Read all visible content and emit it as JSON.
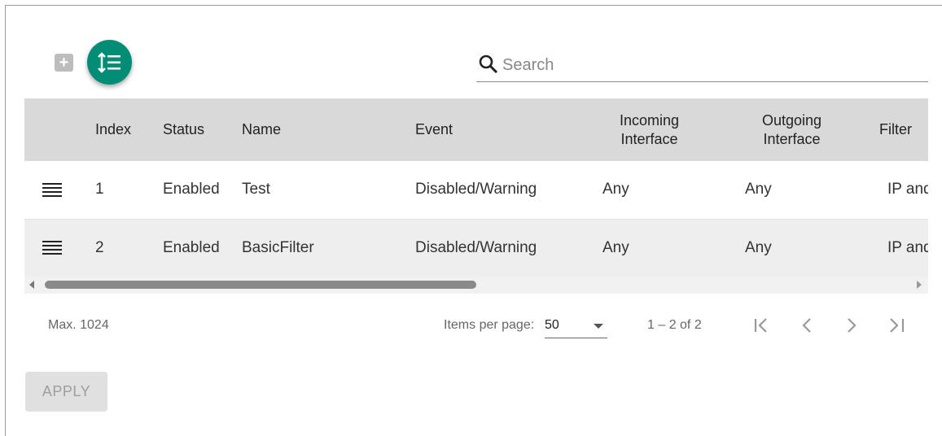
{
  "toolbar": {
    "add_icon": "plus-box-icon",
    "reorder_icon": "reorder-list-icon",
    "fab_color": "#008c75"
  },
  "search": {
    "placeholder": "Search"
  },
  "table": {
    "columns": [
      "",
      "Index",
      "Status",
      "Name",
      "Event",
      "Incoming Interface",
      "Outgoing Interface",
      "Filter"
    ],
    "rows": [
      {
        "index": "1",
        "status": "Enabled",
        "name": "Test",
        "event": "Disabled/Warning",
        "incoming": "Any",
        "outgoing": "Any",
        "filter": "IP and"
      },
      {
        "index": "2",
        "status": "Enabled",
        "name": "BasicFilter",
        "event": "Disabled/Warning",
        "incoming": "Any",
        "outgoing": "Any",
        "filter": "IP and"
      }
    ]
  },
  "footer": {
    "max_text": "Max. 1024",
    "items_per_page_label": "Items per page:",
    "items_per_page_value": "50",
    "range_text": "1 – 2 of 2"
  },
  "apply_label": "APPLY"
}
